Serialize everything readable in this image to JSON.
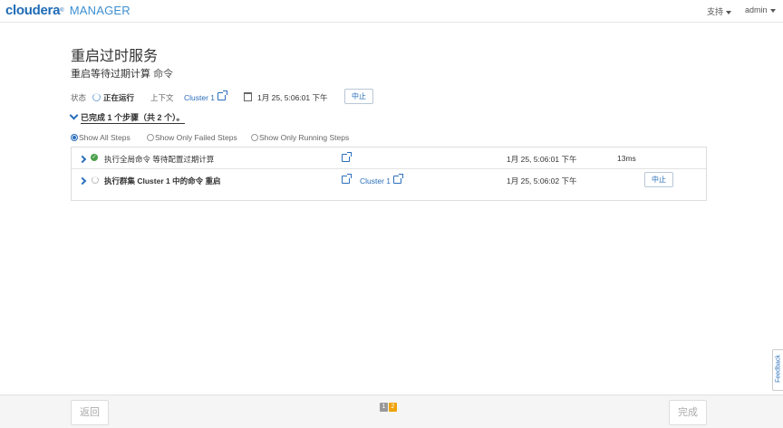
{
  "header": {
    "brand": "cloudera",
    "product": "MANAGER",
    "support_menu": "支持",
    "user_menu": "admin"
  },
  "page": {
    "title": "重启过时服务",
    "subtitle": "重启等待过期计算",
    "subtitle_cmd": "命令"
  },
  "status": {
    "label": "状态",
    "value": "正在运行",
    "context_label": "上下文",
    "context_link": "Cluster 1",
    "timestamp": "1月 25, 5:06:01 下午",
    "abort_button": "中止"
  },
  "progress": {
    "text": "已完成 1 个步骤（共 2 个）。"
  },
  "filters": {
    "options": [
      "Show All Steps",
      "Show Only Failed Steps",
      "Show Only Running Steps"
    ],
    "selected": "Show All Steps"
  },
  "steps": [
    {
      "name": "执行全局命令 等待配置过期计算",
      "status": "completed",
      "context": "",
      "time": "1月 25, 5:06:01 下午",
      "duration": "13ms",
      "action": ""
    },
    {
      "name": "执行群集 Cluster 1 中的命令 重启",
      "status": "running",
      "context": "Cluster 1",
      "time": "1月 25, 5:06:02 下午",
      "duration": "",
      "action": "中止"
    }
  ],
  "footer": {
    "back_button": "返回",
    "finish_button": "完成",
    "pages": [
      "1",
      "2"
    ],
    "current_page": "2"
  },
  "feedback_tab": "Feedback",
  "colors": {
    "brand_blue": "#1f6bb6",
    "link_blue": "#2a6ebb",
    "success_green": "#4ba04b",
    "active_page": "#f0a30a",
    "inactive_page": "#999999"
  }
}
